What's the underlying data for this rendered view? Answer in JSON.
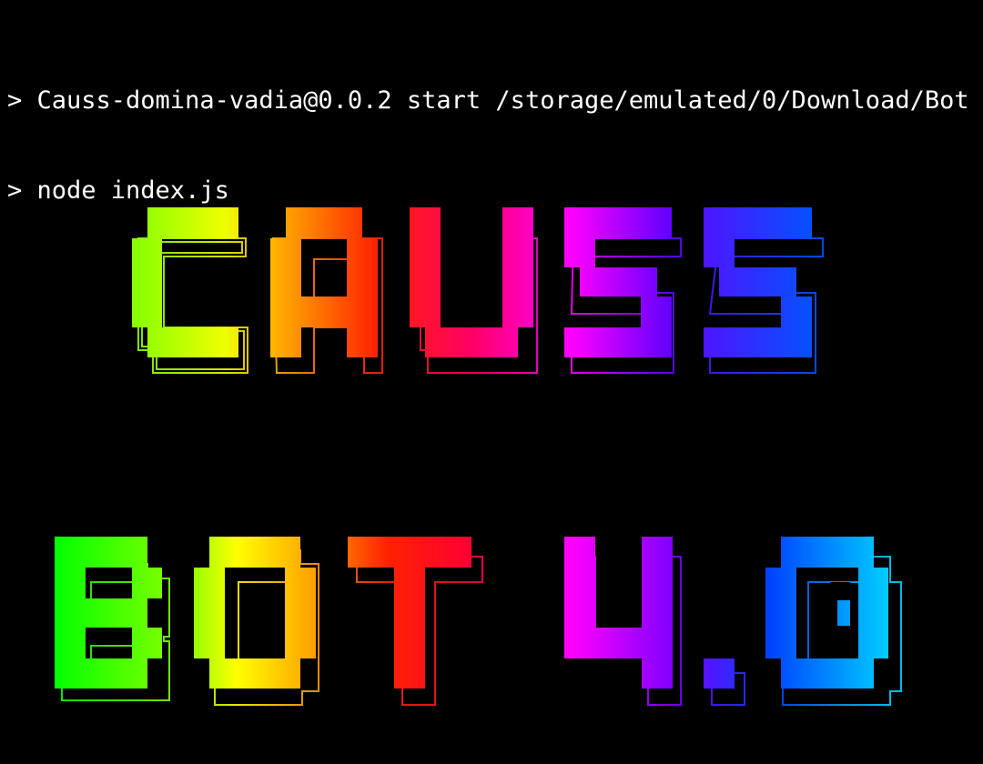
{
  "terminal": {
    "lines": [
      "> Causs-domina-vadia@0.0.2 start /storage/emulated/0/Download/Bot",
      "> node index.js"
    ]
  },
  "banner": {
    "title_line_1": "CAUSS",
    "title_line_2": "BOT 4.0",
    "gradient_colors": [
      "#00ff00",
      "#ffff00",
      "#ff8800",
      "#ff0000",
      "#ff00ff",
      "#8800ff",
      "#0000ff",
      "#00ccff"
    ]
  }
}
